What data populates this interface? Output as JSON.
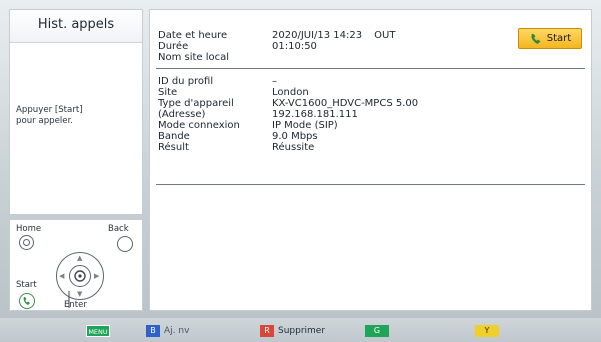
{
  "left": {
    "title": "Hist. appels",
    "instruction_line1": "Appuyer [Start]",
    "instruction_line2": "pour appeler.",
    "nav": {
      "home": "Home",
      "back": "Back",
      "start": "Start",
      "enter": "Enter"
    }
  },
  "call": {
    "labels": {
      "datetime": "Date et heure",
      "duration": "Durée",
      "local_site": "Nom site local"
    },
    "values": {
      "datetime": "2020/JUI/13 14:23",
      "direction": "OUT",
      "duration": "01:10:50",
      "local_site": ""
    },
    "start_button": "Start"
  },
  "details": {
    "labels": {
      "profile_id": "ID du profil",
      "site": "Site",
      "device_type": "Type d'appareil",
      "address": "(Adresse)",
      "connection_mode": "Mode connexion",
      "band": "Bande",
      "result": "Résult"
    },
    "values": {
      "profile_id": "–",
      "site": "London",
      "device_type": "KX-VC1600_HDVC-MPCS 5.00",
      "address": "192.168.181.111",
      "connection_mode": "IP Mode (SIP)",
      "band": "9.0 Mbps",
      "result": "Réussite"
    }
  },
  "bottom_bar": {
    "menu_key": "MENU",
    "b_key": "B",
    "b_label": "Aj. nv",
    "r_key": "R",
    "r_label": "Supprimer",
    "g_key": "G",
    "y_key": "Y"
  },
  "colors": {
    "start_button": "#f3b61f",
    "key_green": "#20a45a",
    "key_blue": "#2f62c8",
    "key_red": "#d9473a",
    "key_yellow": "#f0cf2a"
  },
  "icons": [
    "handset-icon",
    "home-icon",
    "back-icon",
    "enter-dpad-icon",
    "start-call-icon"
  ]
}
